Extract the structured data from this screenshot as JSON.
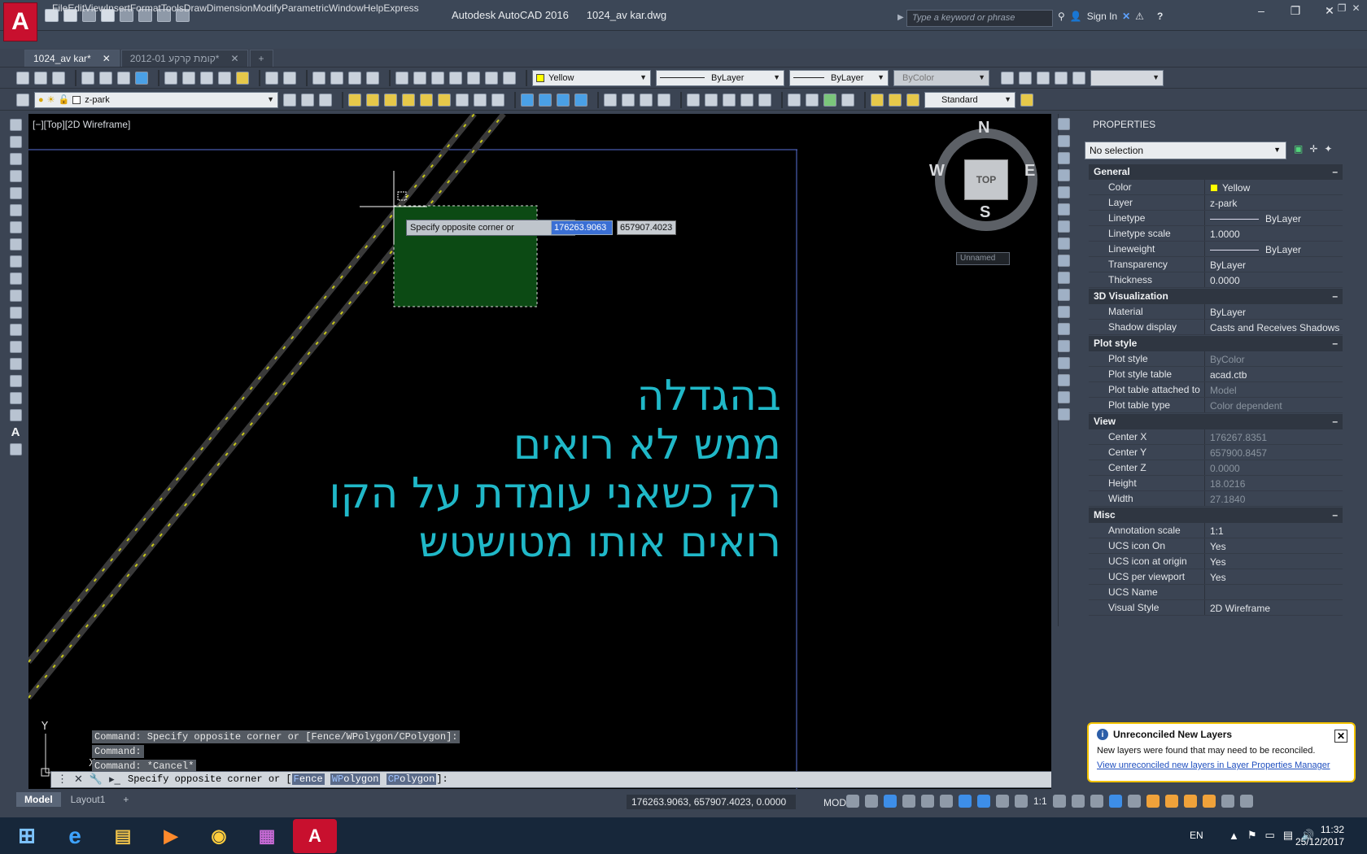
{
  "app": {
    "logo_letter": "A",
    "title": "Autodesk AutoCAD 2016",
    "filename": "1024_av kar.dwg",
    "search_placeholder": "Type a keyword or phrase",
    "sign_in": "Sign In",
    "help": "?"
  },
  "window_buttons": [
    "–",
    "❐",
    "✕"
  ],
  "menu": [
    "File",
    "Edit",
    "View",
    "Insert",
    "Format",
    "Tools",
    "Draw",
    "Dimension",
    "Modify",
    "Parametric",
    "Window",
    "Help",
    "Express"
  ],
  "doc_tabs": [
    {
      "label": "1024_av kar*",
      "active": true
    },
    {
      "label": "2012-01 קומת קרקע*",
      "active": false
    }
  ],
  "tab_close": "✕",
  "tab_add": "+",
  "toolbar": {
    "color": "Yellow",
    "color_hex": "#ffff00",
    "linetype": "ByLayer",
    "lineweight": "ByLayer",
    "plotstyle": "ByColor",
    "layer": "z-park",
    "text_style": "Standard"
  },
  "viewport": {
    "label": "[−][Top][2D Wireframe]",
    "hebrew_lines": [
      "בהגדלה",
      "ממש לא רואים",
      "רק כשאני עומדת על הקו",
      "רואים אותו מטושטש"
    ],
    "ucs_y": "Y",
    "ucs_x": "X"
  },
  "dynamic_input": {
    "prompt": "Specify opposite corner or",
    "x_value": "176263.9063",
    "y_value": "657907.4023"
  },
  "viewcube": {
    "top": "TOP",
    "n": "N",
    "s": "S",
    "e": "E",
    "w": "W",
    "ucs_name": "Unnamed"
  },
  "command_history": [
    "Command: Specify opposite corner or [Fence/WPolygon/CPolygon]:",
    "Command:",
    "Command: *Cancel*"
  ],
  "command_line": {
    "prefix": "Specify opposite corner or [",
    "opt1_key": "F",
    "opt1_rest": "ence",
    "opt2_key": "WP",
    "opt2_rest": "olygon",
    "opt3_key": "CP",
    "opt3_rest": "olygon",
    "suffix": "]:"
  },
  "model_tabs": [
    "Model",
    "Layout1",
    "+"
  ],
  "status": {
    "coords": "176263.9063, 657907.4023, 0.0000",
    "mode": "MODEL",
    "scale": "1:1"
  },
  "properties": {
    "title": "PROPERTIES",
    "selection": "No selection",
    "collapse": "–",
    "sections": [
      {
        "title": "General",
        "rows": [
          {
            "k": "Color",
            "v": "Yellow"
          },
          {
            "k": "Layer",
            "v": "z-park"
          },
          {
            "k": "Linetype",
            "v": "ByLayer"
          },
          {
            "k": "Linetype scale",
            "v": "1.0000"
          },
          {
            "k": "Lineweight",
            "v": "ByLayer"
          },
          {
            "k": "Transparency",
            "v": "ByLayer"
          },
          {
            "k": "Thickness",
            "v": "0.0000"
          }
        ]
      },
      {
        "title": "3D Visualization",
        "rows": [
          {
            "k": "Material",
            "v": "ByLayer"
          },
          {
            "k": "Shadow display",
            "v": "Casts and Receives Shadows"
          }
        ]
      },
      {
        "title": "Plot style",
        "rows": [
          {
            "k": "Plot style",
            "v": "ByColor"
          },
          {
            "k": "Plot style table",
            "v": "acad.ctb"
          },
          {
            "k": "Plot table attached to",
            "v": "Model"
          },
          {
            "k": "Plot table type",
            "v": "Color dependent"
          }
        ]
      },
      {
        "title": "View",
        "rows": [
          {
            "k": "Center X",
            "v": "176267.8351"
          },
          {
            "k": "Center Y",
            "v": "657900.8457"
          },
          {
            "k": "Center Z",
            "v": "0.0000"
          },
          {
            "k": "Height",
            "v": "18.0216"
          },
          {
            "k": "Width",
            "v": "27.1840"
          }
        ]
      },
      {
        "title": "Misc",
        "rows": [
          {
            "k": "Annotation scale",
            "v": "1:1"
          },
          {
            "k": "UCS icon On",
            "v": "Yes"
          },
          {
            "k": "UCS icon at origin",
            "v": "Yes"
          },
          {
            "k": "UCS per viewport",
            "v": "Yes"
          },
          {
            "k": "UCS Name",
            "v": ""
          },
          {
            "k": "Visual Style",
            "v": "2D Wireframe"
          }
        ]
      }
    ]
  },
  "notification": {
    "info": "i",
    "close": "✕",
    "title": "Unreconciled New Layers",
    "body": "New layers were found that may need to be reconciled.",
    "link": "View unreconciled new layers in Layer Properties Manager"
  },
  "taskbar": {
    "lang": "EN",
    "time": "11:32",
    "date": "25/12/2017",
    "apps": [
      "start",
      "internet-explorer",
      "file-explorer",
      "media-player",
      "chrome",
      "winrar",
      "autocad"
    ],
    "app_glyphs": [
      "⊞",
      "e",
      "▤",
      "▶",
      "◉",
      "▦",
      "A"
    ]
  }
}
